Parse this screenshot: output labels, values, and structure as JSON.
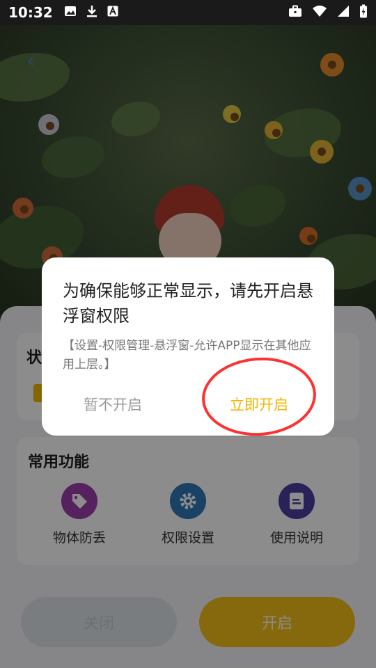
{
  "statusbar": {
    "time": "10:32"
  },
  "panel": {
    "status_title": "状",
    "functions_title": "常用功能",
    "functions": [
      {
        "label": "物体防丢",
        "icon": "tag-icon",
        "color": "#9b3fae"
      },
      {
        "label": "权限设置",
        "icon": "gear-icon",
        "color": "#2e78b8"
      },
      {
        "label": "使用说明",
        "icon": "document-icon",
        "color": "#4b3fa0"
      }
    ],
    "close_label": "关闭",
    "open_label": "开启"
  },
  "dialog": {
    "title": "为确保能够正常显示，请先开启悬浮窗权限",
    "message": "【设置-权限管理-悬浮窗-允许APP显示在其他应用上层。】",
    "cancel_label": "暂不开启",
    "confirm_label": "立即开启"
  },
  "colors": {
    "accent": "#f5be18",
    "highlight_annotation": "#ff3030"
  }
}
